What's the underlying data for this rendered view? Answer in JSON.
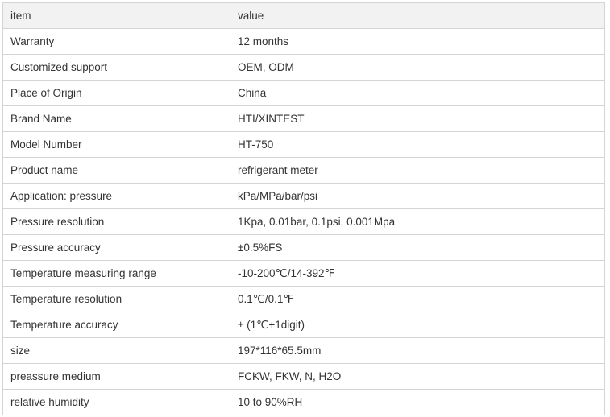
{
  "table": {
    "header": {
      "item": "item",
      "value": "value"
    },
    "rows": [
      {
        "item": "Warranty",
        "value": "12 months"
      },
      {
        "item": "Customized support",
        "value": "OEM, ODM"
      },
      {
        "item": "Place of Origin",
        "value": "China"
      },
      {
        "item": "Brand Name",
        "value": "HTI/XINTEST"
      },
      {
        "item": "Model Number",
        "value": "HT-750"
      },
      {
        "item": "Product name",
        "value": "refrigerant meter"
      },
      {
        "item": "Application: pressure",
        "value": "kPa/MPa/bar/psi"
      },
      {
        "item": "Pressure resolution",
        "value": "1Kpa, 0.01bar, 0.1psi, 0.001Mpa"
      },
      {
        "item": "Pressure accuracy",
        "value": "±0.5%FS"
      },
      {
        "item": "Temperature measuring range",
        "value": "-10-200℃/14-392℉"
      },
      {
        "item": "Temperature resolution",
        "value": "0.1℃/0.1℉"
      },
      {
        "item": "Temperature accuracy",
        "value": "± (1℃+1digit)"
      },
      {
        "item": "size",
        "value": "197*116*65.5mm"
      },
      {
        "item": "preassure medium",
        "value": "FCKW, FKW, N, H2O"
      },
      {
        "item": "relative humidity",
        "value": "10 to 90%RH"
      }
    ]
  }
}
